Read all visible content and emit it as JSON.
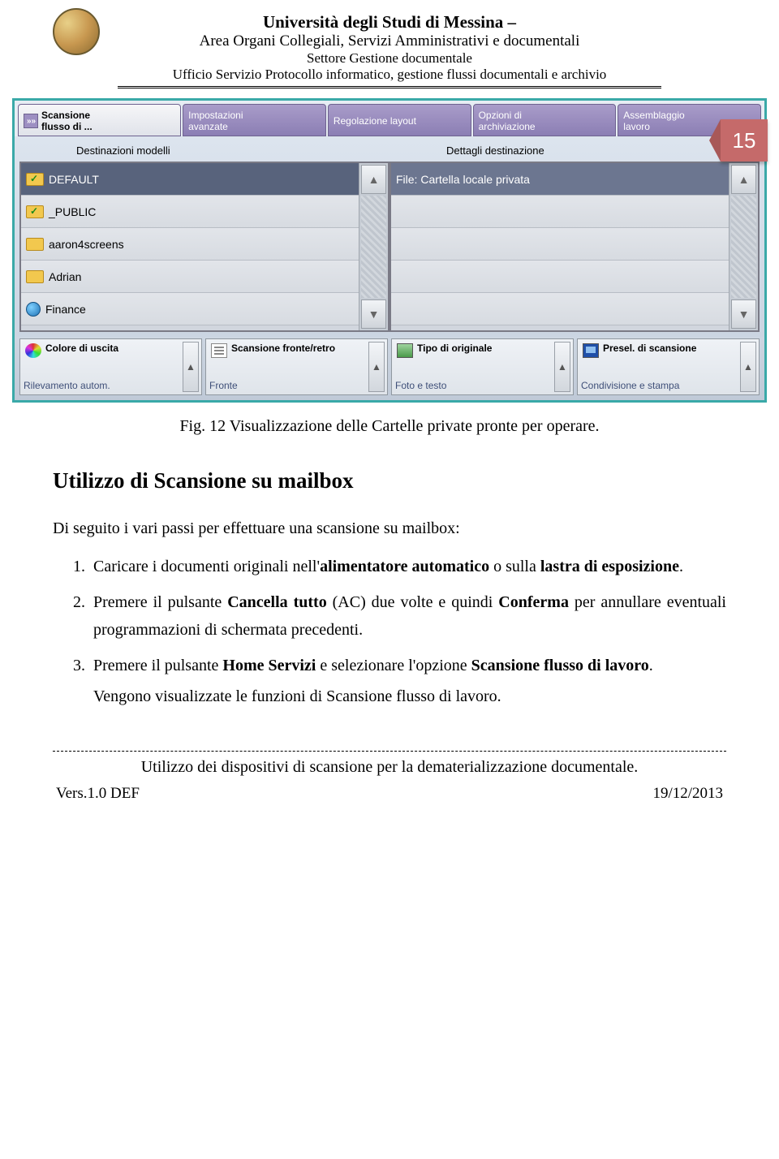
{
  "header": {
    "line1": "Università degli Studi di Messina –",
    "line2": "Area Organi Collegiali, Servizi Amministrativi e documentali",
    "line3": "Settore Gestione documentale",
    "line4": "Ufficio Servizio Protocollo informatico, gestione flussi documentali e archivio"
  },
  "page_number": "15",
  "screenshot": {
    "tabs": [
      {
        "label": "Scansione\nflusso di ...",
        "active": true
      },
      {
        "label": "Impostazioni\navanzate",
        "active": false
      },
      {
        "label": "Regolazione layout",
        "active": false
      },
      {
        "label": "Opzioni di\narchiviazione",
        "active": false
      },
      {
        "label": "Assemblaggio\nlavoro",
        "active": false
      }
    ],
    "left_label": "Destinazioni modelli",
    "right_label": "Dettagli destinazione",
    "models": [
      {
        "name": "DEFAULT",
        "variant": "dark",
        "icon": "folder-check"
      },
      {
        "name": "_PUBLIC",
        "variant": "light",
        "icon": "folder-check"
      },
      {
        "name": "aaron4screens",
        "variant": "light",
        "icon": "folder"
      },
      {
        "name": "Adrian",
        "variant": "light",
        "icon": "folder"
      },
      {
        "name": "Finance",
        "variant": "light",
        "icon": "globe"
      }
    ],
    "details": [
      {
        "text": "File: Cartella locale privata"
      }
    ],
    "bottom": [
      {
        "title": "Colore di uscita",
        "sub": "Rilevamento autom.",
        "icon": "color"
      },
      {
        "title": "Scansione\nfronte/retro",
        "sub": "Fronte",
        "icon": "doc"
      },
      {
        "title": "Tipo di\noriginale",
        "sub": "Foto e testo",
        "icon": "photo"
      },
      {
        "title": "Presel. di\nscansione",
        "sub": "Condivisione e stampa",
        "icon": "screen"
      }
    ]
  },
  "caption": "Fig. 12 Visualizzazione delle Cartelle private pronte per operare.",
  "section_title": "Utilizzo di Scansione su mailbox",
  "intro": "Di seguito i vari passi per effettuare una scansione su mailbox:",
  "steps": {
    "s1_a": "Caricare i documenti originali nell'",
    "s1_b": "alimentatore automatico",
    "s1_c": " o sulla ",
    "s1_d": "lastra di esposizione",
    "s1_e": ".",
    "s2_a": "Premere il pulsante ",
    "s2_b": "Cancella tutto",
    "s2_c": " (AC) due volte e quindi ",
    "s2_d": "Conferma",
    "s2_e": " per annullare eventuali programmazioni di schermata precedenti.",
    "s3_a": "Premere il pulsante ",
    "s3_b": "Home Servizi",
    "s3_c": " e selezionare l'opzione ",
    "s3_d": "Scansione flusso di lavoro",
    "s3_e": "."
  },
  "after_note": "Vengono visualizzate le funzioni di Scansione flusso di lavoro.",
  "footer": {
    "title": "Utilizzo dei dispositivi di scansione per la dematerializzazione documentale.",
    "left": "Vers.1.0 DEF",
    "right": "19/12/2013"
  }
}
